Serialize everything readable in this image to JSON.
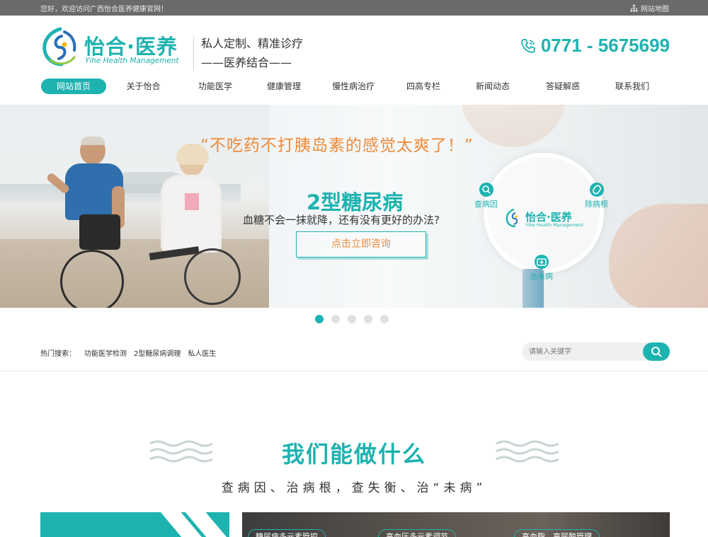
{
  "topbar": {
    "welcome": "您好，欢迎访问广西怡合医养健康官网！",
    "sitemap": "网站地图"
  },
  "header": {
    "logo_cn": "怡合·医养",
    "logo_en": "Yihe Health Management",
    "slogan_line1": "私人定制、精准诊疗",
    "slogan_line2": "——医养结合——",
    "phone": "0771 - 5675699"
  },
  "nav": {
    "items": [
      {
        "label": "网站首页",
        "active": true
      },
      {
        "label": "关于怡合"
      },
      {
        "label": "功能医学"
      },
      {
        "label": "健康管理"
      },
      {
        "label": "慢性病治疗"
      },
      {
        "label": "四高专栏"
      },
      {
        "label": "新闻动态"
      },
      {
        "label": "答疑解惑"
      },
      {
        "label": "联系我们"
      }
    ]
  },
  "banner": {
    "quote": "“不吃药不打胰岛素的感觉太爽了！”",
    "title": "2型糖尿病",
    "subtitle": "血糖不会一抹就降，还有没有更好的办法?",
    "cta": "点击立即咨询",
    "lens_logo_cn": "怡合·医养",
    "lens_logo_en": "Yihe Health Management",
    "tag_find": "查病因",
    "tag_cure": "除病根",
    "tag_prevent": "治未病",
    "slide_count": 5,
    "active_slide": 1
  },
  "hot_search": {
    "label": "热门搜索：",
    "keywords": [
      "功能医学检测",
      "2型糖尿病调理",
      "私人医生"
    ]
  },
  "search": {
    "placeholder": "请输入关键字"
  },
  "section": {
    "title": "我们能做什么",
    "subtitle": "查病因、治病根，查失衡、治“未病”"
  },
  "cards": {
    "pills": [
      "糖尿病多元素管控",
      "高血压多元素调节",
      "高血脂、高尿酸管理"
    ]
  },
  "colors": {
    "accent": "#1db3b0",
    "orange": "#ee8a3a",
    "topbar": "#6a6a6a"
  }
}
